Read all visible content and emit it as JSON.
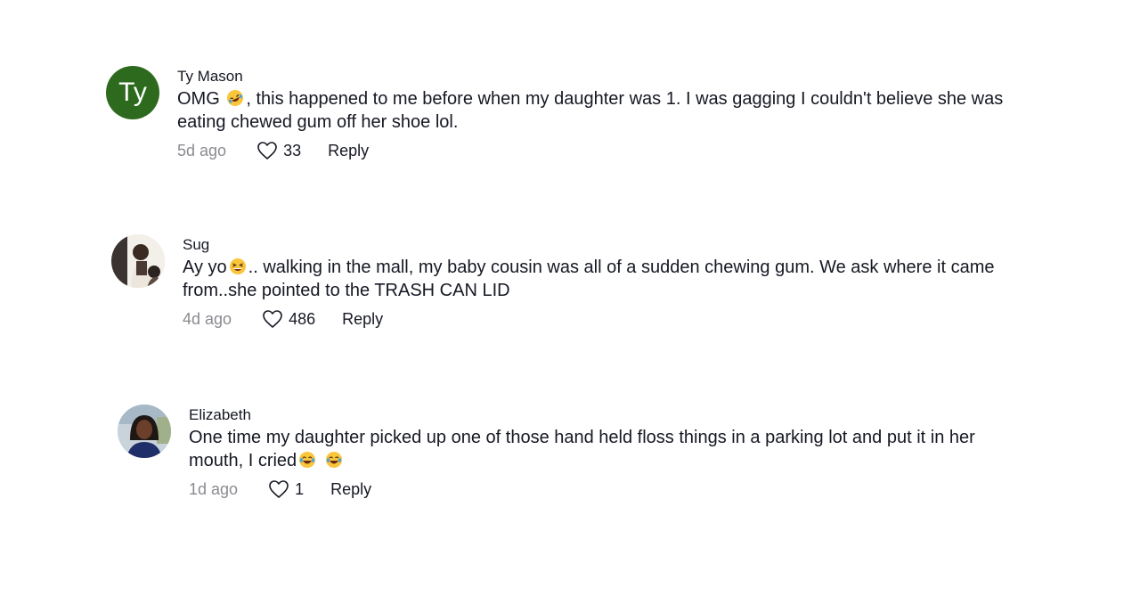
{
  "comments": [
    {
      "username": "Ty Mason",
      "avatar_initials": "Ty",
      "text_before": "OMG ",
      "emoji_1": "rolling-on-floor-laughing-emoji",
      "text_after": ", this happened to me before when my daughter was 1. I was gagging I couldn't believe she was eating chewed gum off her shoe lol.",
      "time": "5d ago",
      "likes": "33",
      "reply_label": "Reply"
    },
    {
      "username": "Sug",
      "avatar_type": "photo",
      "text_before": "Ay yo",
      "emoji_1": "tired-face-emoji",
      "text_after": ".. walking in the mall, my baby cousin was all of a sudden chewing gum. We ask where it came from..she pointed to the TRASH CAN LID",
      "time": "4d ago",
      "likes": "486",
      "reply_label": "Reply"
    },
    {
      "username": "Elizabeth",
      "avatar_type": "photo",
      "text_before": "One time my daughter picked up one of those hand held floss things in a parking lot and put it in her mouth, I cried",
      "emoji_1": "face-with-tears-of-joy-emoji",
      "emoji_2": "face-with-tears-of-joy-emoji",
      "time": "1d ago",
      "likes": "1",
      "reply_label": "Reply"
    }
  ],
  "colors": {
    "avatar_green": "#2d6a1e",
    "text": "#161823",
    "muted": "#8a8b91"
  }
}
